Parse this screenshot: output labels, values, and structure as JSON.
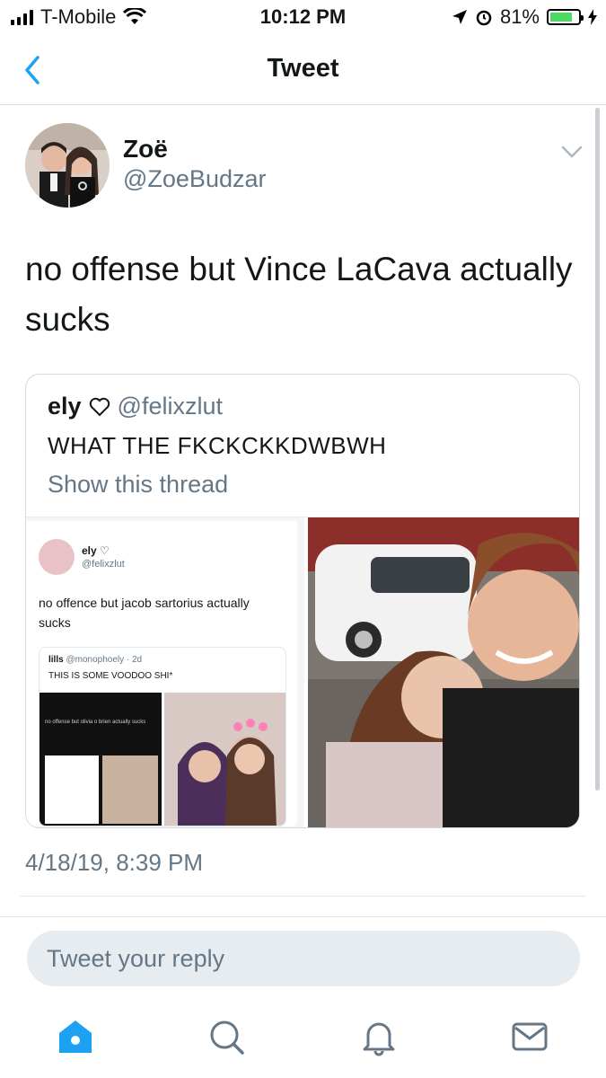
{
  "status_bar": {
    "carrier": "T-Mobile",
    "time": "10:12 PM",
    "battery_percent": "81%",
    "battery_level": 0.81,
    "icons": [
      "signal-icon",
      "wifi-icon",
      "location-icon",
      "alarm-icon",
      "battery-icon",
      "charging-icon"
    ]
  },
  "nav": {
    "title": "Tweet",
    "back_icon": "chevron-left-icon"
  },
  "tweet": {
    "author_name": "Zoë",
    "author_handle": "@ZoeBudzar",
    "text": "no offense but Vince LaCava actually sucks",
    "timestamp": "4/18/19, 8:39 PM"
  },
  "quoted_tweet": {
    "author_name": "ely",
    "author_handle": "@felixzlut",
    "text": "WHAT THE FKCKCKKDWBWH",
    "show_thread": "Show this thread",
    "embedded_screenshot": {
      "author_name": "ely",
      "author_handle": "@felixzlut",
      "text": "no offence but jacob sartorius actually sucks",
      "quote_author": "lills",
      "quote_handle": "@monophoely · 2d",
      "quote_text": "THIS IS SOME VOODOO SHI*",
      "nested_text": "no offense but olivia o brien actually sucks"
    }
  },
  "reply": {
    "placeholder": "Tweet your reply"
  },
  "tabbar": [
    "home-icon",
    "search-icon",
    "notifications-icon",
    "messages-icon"
  ],
  "colors": {
    "accent": "#1da1f2",
    "secondary_text": "#657786",
    "battery_fill": "#4cd964"
  }
}
